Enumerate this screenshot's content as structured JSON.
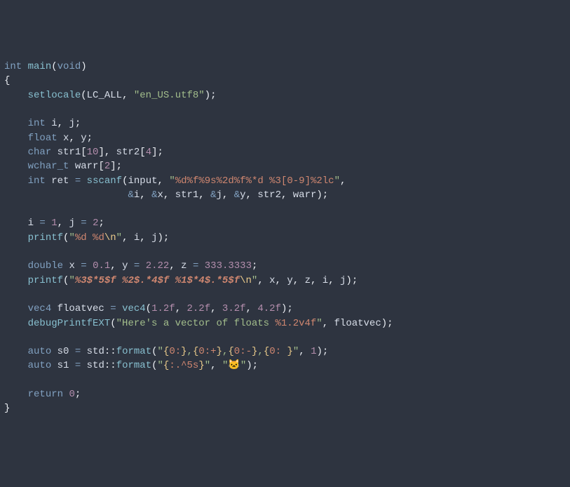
{
  "code": {
    "l1": {
      "t_int": "int",
      "fn": "main",
      "lp": "(",
      "t_void": "void",
      "rp": ")"
    },
    "l2": {
      "brace": "{"
    },
    "l3": {
      "indent": "    ",
      "fn": "setlocale",
      "lp": "(",
      "arg1": "LC_ALL",
      "c": ", ",
      "q1": "\"",
      "s": "en_US.utf8",
      "q2": "\"",
      "rp": ")",
      "sc": ";"
    },
    "l4": "",
    "l5": {
      "indent": "    ",
      "t": "int",
      "sp": " ",
      "v1": "i",
      "c": ", ",
      "v2": "j",
      "sc": ";"
    },
    "l6": {
      "indent": "    ",
      "t": "float",
      "sp": " ",
      "v1": "x",
      "c": ", ",
      "v2": "y",
      "sc": ";"
    },
    "l7": {
      "indent": "    ",
      "t": "char",
      "sp": " ",
      "v1": "str1",
      "lb1": "[",
      "n1": "10",
      "rb1": "]",
      "c": ", ",
      "v2": "str2",
      "lb2": "[",
      "n2": "4",
      "rb2": "]",
      "sc": ";"
    },
    "l8": {
      "indent": "    ",
      "t": "wchar_t",
      "sp": " ",
      "v": "warr",
      "lb": "[",
      "n": "2",
      "rb": "]",
      "sc": ";"
    },
    "l9": {
      "indent": "    ",
      "t": "int",
      "sp": " ",
      "v": "ret",
      "eq": " = ",
      "fn": "sscanf",
      "lp": "(",
      "a1": "input",
      "c1": ", ",
      "q1": "\"",
      "f1": "%d%f%9s%2d%f%*d %3[0-9]%2lc",
      "q2": "\"",
      "c2": ","
    },
    "l10": {
      "indent": "                     ",
      "amp1": "&",
      "a1": "i",
      "c1": ", ",
      "amp2": "&",
      "a2": "x",
      "c2": ", ",
      "a3": "str1",
      "c3": ", ",
      "amp3": "&",
      "a4": "j",
      "c4": ", ",
      "amp4": "&",
      "a5": "y",
      "c5": ", ",
      "a6": "str2",
      "c6": ", ",
      "a7": "warr",
      "rp": ")",
      "sc": ";"
    },
    "l11": "",
    "l12": {
      "indent": "    ",
      "v1": "i",
      "eq1": " = ",
      "n1": "1",
      "c": ", ",
      "v2": "j",
      "eq2": " = ",
      "n2": "2",
      "sc": ";"
    },
    "l13": {
      "indent": "    ",
      "fn": "printf",
      "lp": "(",
      "q1": "\"",
      "f1": "%d %d",
      "esc": "\\n",
      "q2": "\"",
      "c1": ", ",
      "a1": "i",
      "c2": ", ",
      "a2": "j",
      "rp": ")",
      "sc": ";"
    },
    "l14": "",
    "l15": {
      "indent": "    ",
      "t": "double",
      "sp": " ",
      "v1": "x",
      "eq1": " = ",
      "n1": "0.1",
      "c1": ", ",
      "v2": "y",
      "eq2": " = ",
      "n2": "2.22",
      "c2": ", ",
      "v3": "z",
      "eq3": " = ",
      "n3": "333.3333",
      "sc": ";"
    },
    "l16": {
      "indent": "    ",
      "fn": "printf",
      "lp": "(",
      "q1": "\"",
      "f1": "%3$*5$f",
      "sp1": " ",
      "f2": "%2$.*4$f",
      "sp2": " ",
      "f3": "%1$*4$.*5$f",
      "esc": "\\n",
      "q2": "\"",
      "c1": ", ",
      "a1": "x",
      "c2": ", ",
      "a2": "y",
      "c3": ", ",
      "a3": "z",
      "c4": ", ",
      "a4": "i",
      "c5": ", ",
      "a5": "j",
      "rp": ")",
      "sc": ";"
    },
    "l17": "",
    "l18": {
      "indent": "    ",
      "t": "vec4",
      "sp": " ",
      "v": "floatvec",
      "eq": " = ",
      "fn": "vec4",
      "lp": "(",
      "n1": "1.2f",
      "c1": ", ",
      "n2": "2.2f",
      "c2": ", ",
      "n3": "3.2f",
      "c3": ", ",
      "n4": "4.2f",
      "rp": ")",
      "sc": ";"
    },
    "l19": {
      "indent": "    ",
      "fn": "debugPrintfEXT",
      "lp": "(",
      "q1": "\"",
      "s1": "Here's a vector of floats ",
      "f1": "%1.2v4f",
      "q2": "\"",
      "c": ", ",
      "a": "floatvec",
      "rp": ")",
      "sc": ";"
    },
    "l20": "",
    "l21": {
      "indent": "    ",
      "t": "auto",
      "sp": " ",
      "v": "s0",
      "eq": " = ",
      "ns": "std",
      "cc": "::",
      "fn": "format",
      "lp": "(",
      "q1": "\"",
      "b1a": "{",
      "f1": "0:",
      "b1b": "}",
      "s1": ",",
      "b2a": "{",
      "f2": "0:+",
      "b2b": "}",
      "s2": ",",
      "b3a": "{",
      "f3": "0:-",
      "b3b": "}",
      "s3": ",",
      "b4a": "{",
      "f4": "0: ",
      "b4b": "}",
      "q2": "\"",
      "c": ", ",
      "n": "1",
      "rp": ")",
      "sc": ";"
    },
    "l22": {
      "indent": "    ",
      "t": "auto",
      "sp": " ",
      "v": "s1",
      "eq": " = ",
      "ns": "std",
      "cc": "::",
      "fn": "format",
      "lp": "(",
      "q1": "\"",
      "b1a": "{",
      "f1": ":.^5s",
      "b1b": "}",
      "q2": "\"",
      "c": ", ",
      "q3": "\"",
      "emoji": "🐱",
      "q4": "\"",
      "rp": ")",
      "sc": ";"
    },
    "l23": "",
    "l24": {
      "indent": "    ",
      "kw": "return",
      "sp": " ",
      "n": "0",
      "sc": ";"
    },
    "l25": {
      "brace": "}"
    }
  }
}
